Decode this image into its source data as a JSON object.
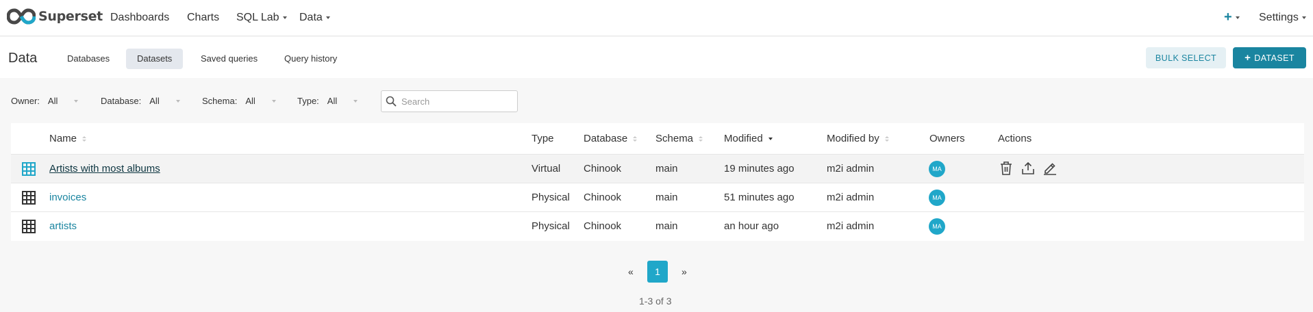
{
  "brand": {
    "name": "Superset"
  },
  "nav": {
    "items": [
      {
        "label": "Dashboards"
      },
      {
        "label": "Charts"
      },
      {
        "label": "SQL Lab"
      },
      {
        "label": "Data"
      }
    ],
    "plus_label": "+",
    "settings_label": "Settings"
  },
  "subheader": {
    "title": "Data",
    "tabs": [
      {
        "label": "Databases"
      },
      {
        "label": "Datasets",
        "active": true
      },
      {
        "label": "Saved queries"
      },
      {
        "label": "Query history"
      }
    ],
    "bulk_select_label": "BULK SELECT",
    "add_dataset_label": "DATASET",
    "add_dataset_icon": "+"
  },
  "filters": {
    "owner": {
      "label": "Owner:",
      "value": "All"
    },
    "database": {
      "label": "Database:",
      "value": "All"
    },
    "schema": {
      "label": "Schema:",
      "value": "All"
    },
    "type": {
      "label": "Type:",
      "value": "All"
    },
    "search_placeholder": "Search"
  },
  "table": {
    "headers": {
      "name": "Name",
      "type": "Type",
      "database": "Database",
      "schema": "Schema",
      "modified": "Modified",
      "modified_by": "Modified by",
      "owners": "Owners",
      "actions": "Actions"
    },
    "rows": [
      {
        "name": "Artists with most albums",
        "type": "Virtual",
        "database": "Chinook",
        "schema": "main",
        "modified": "19 minutes ago",
        "modified_by": "m2i admin",
        "owner_initials": "MA",
        "icon": "table-grid-icon"
      },
      {
        "name": "invoices",
        "type": "Physical",
        "database": "Chinook",
        "schema": "main",
        "modified": "51 minutes ago",
        "modified_by": "m2i admin",
        "owner_initials": "MA",
        "icon": "table-grid-icon"
      },
      {
        "name": "artists",
        "type": "Physical",
        "database": "Chinook",
        "schema": "main",
        "modified": "an hour ago",
        "modified_by": "m2i admin",
        "owner_initials": "MA",
        "icon": "table-grid-icon"
      }
    ]
  },
  "pagination": {
    "prev": "«",
    "page": "1",
    "next": "»",
    "count": "1-3 of 3"
  },
  "colors": {
    "primary": "#1a85a0",
    "accent": "#20a7c9",
    "active_tab": "#e4e8ee"
  }
}
